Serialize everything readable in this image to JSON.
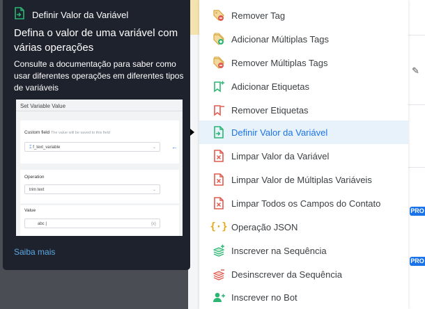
{
  "tooltip": {
    "header_label": "Definir Valor da Variável",
    "title": "Defina o valor de uma variável com várias operações",
    "description": "Consulte a documentação para saber como usar diferentes operações em diferentes tipos de variáveis",
    "learn_more": "Saiba mais",
    "preview": {
      "title": "Set Variable Value",
      "custom_field_label": "Custom field",
      "custom_field_hint": "The value will be saved to this field",
      "custom_field_value": "f_text_variable",
      "operation_label": "Operation",
      "operation_value": "trim text",
      "value_label": "Value",
      "value_value": "abc"
    }
  },
  "menu": {
    "items": [
      {
        "label": "Remover Tag",
        "icon": "tag-remove-icon"
      },
      {
        "label": "Adicionar Múltiplas Tags",
        "icon": "tags-add-icon"
      },
      {
        "label": "Remover Múltiplas Tags",
        "icon": "tags-remove-icon"
      },
      {
        "label": "Adicionar Etiquetas",
        "icon": "bookmark-add-icon"
      },
      {
        "label": "Remover Etiquetas",
        "icon": "bookmark-remove-icon"
      },
      {
        "label": "Definir Valor da Variável",
        "icon": "file-variable-icon",
        "active": true
      },
      {
        "label": "Limpar Valor da Variável",
        "icon": "file-clear-icon"
      },
      {
        "label": "Limpar Valor de Múltiplas Variáveis",
        "icon": "file-clear-multi-icon"
      },
      {
        "label": "Limpar Todos os Campos do Contato",
        "icon": "file-clear-all-icon"
      },
      {
        "label": "Operação JSON",
        "icon": "json-braces-icon"
      },
      {
        "label": "Inscrever na Sequência",
        "icon": "sequence-subscribe-icon"
      },
      {
        "label": "Desinscrever da Sequência",
        "icon": "sequence-unsubscribe-icon"
      },
      {
        "label": "Inscrever no Bot",
        "icon": "user-add-icon"
      }
    ]
  },
  "background": {
    "badge_top": "PRO",
    "badge_bottom": "PRO"
  },
  "colors": {
    "accent": "#1a73e8",
    "tooltip_bg": "#1e222c",
    "active_row": "#e8f2fb",
    "remove_red": "#e05a4f",
    "add_green": "#2bb673",
    "json_yellow": "#e6a817"
  }
}
